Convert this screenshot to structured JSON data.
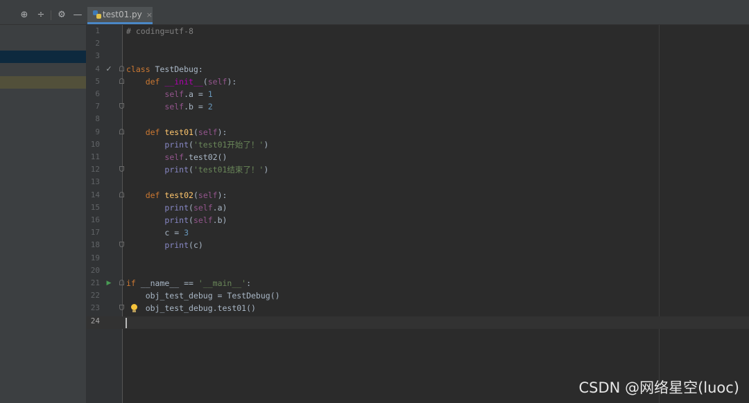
{
  "tab": {
    "label": "test01.py",
    "close": "×"
  },
  "toolbar": {
    "locate_icon": "⊕",
    "collapse_icon": "÷",
    "gear_icon": "⚙",
    "hide_icon": "—"
  },
  "lines": [
    {
      "n": "1",
      "t": [
        [
          "cmt",
          "# coding=utf-8"
        ]
      ]
    },
    {
      "n": "2",
      "t": []
    },
    {
      "n": "3",
      "t": []
    },
    {
      "n": "4",
      "t": [
        [
          "kw",
          "class "
        ],
        [
          "",
          "TestDebug:"
        ]
      ]
    },
    {
      "n": "5",
      "t": [
        [
          "",
          "    "
        ],
        [
          "kw",
          "def "
        ],
        [
          "magic",
          "__init__"
        ],
        [
          "",
          "("
        ],
        [
          "self",
          "self"
        ],
        [
          "",
          "):"
        ]
      ]
    },
    {
      "n": "6",
      "t": [
        [
          "",
          "        "
        ],
        [
          "self",
          "self"
        ],
        [
          "",
          ".a = "
        ],
        [
          "num",
          "1"
        ]
      ]
    },
    {
      "n": "7",
      "t": [
        [
          "",
          "        "
        ],
        [
          "self",
          "self"
        ],
        [
          "",
          ".b = "
        ],
        [
          "num",
          "2"
        ]
      ]
    },
    {
      "n": "8",
      "t": []
    },
    {
      "n": "9",
      "t": [
        [
          "",
          "    "
        ],
        [
          "kw",
          "def "
        ],
        [
          "fn",
          "test01"
        ],
        [
          "",
          "("
        ],
        [
          "self",
          "self"
        ],
        [
          "",
          "):"
        ]
      ]
    },
    {
      "n": "10",
      "t": [
        [
          "",
          "        "
        ],
        [
          "builtin",
          "print"
        ],
        [
          "",
          "("
        ],
        [
          "str",
          "'test01开始了！'"
        ],
        [
          "",
          ")"
        ]
      ]
    },
    {
      "n": "11",
      "t": [
        [
          "",
          "        "
        ],
        [
          "self",
          "self"
        ],
        [
          "",
          ".test02()"
        ]
      ]
    },
    {
      "n": "12",
      "t": [
        [
          "",
          "        "
        ],
        [
          "builtin",
          "print"
        ],
        [
          "",
          "("
        ],
        [
          "str",
          "'test01结束了！'"
        ],
        [
          "",
          ")"
        ]
      ]
    },
    {
      "n": "13",
      "t": []
    },
    {
      "n": "14",
      "t": [
        [
          "",
          "    "
        ],
        [
          "kw",
          "def "
        ],
        [
          "fn",
          "test02"
        ],
        [
          "",
          "("
        ],
        [
          "self",
          "self"
        ],
        [
          "",
          "):"
        ]
      ]
    },
    {
      "n": "15",
      "t": [
        [
          "",
          "        "
        ],
        [
          "builtin",
          "print"
        ],
        [
          "",
          "("
        ],
        [
          "self",
          "self"
        ],
        [
          "",
          ".a)"
        ]
      ]
    },
    {
      "n": "16",
      "t": [
        [
          "",
          "        "
        ],
        [
          "builtin",
          "print"
        ],
        [
          "",
          "("
        ],
        [
          "self",
          "self"
        ],
        [
          "",
          ".b)"
        ]
      ]
    },
    {
      "n": "17",
      "t": [
        [
          "",
          "        c = "
        ],
        [
          "num",
          "3"
        ]
      ]
    },
    {
      "n": "18",
      "t": [
        [
          "",
          "        "
        ],
        [
          "builtin",
          "print"
        ],
        [
          "",
          "(c)"
        ]
      ]
    },
    {
      "n": "19",
      "t": []
    },
    {
      "n": "20",
      "t": []
    },
    {
      "n": "21",
      "t": [
        [
          "kw",
          "if "
        ],
        [
          "",
          "__name__ == "
        ],
        [
          "str",
          "'__main__'"
        ],
        [
          "",
          ":"
        ]
      ]
    },
    {
      "n": "22",
      "t": [
        [
          "",
          "    obj_test_debug = TestDebug()"
        ]
      ]
    },
    {
      "n": "23",
      "t": [
        [
          "",
          "    obj_test_debug.test01()"
        ]
      ]
    },
    {
      "n": "24",
      "t": []
    }
  ],
  "watermark": "CSDN @网络星空(luoc)"
}
